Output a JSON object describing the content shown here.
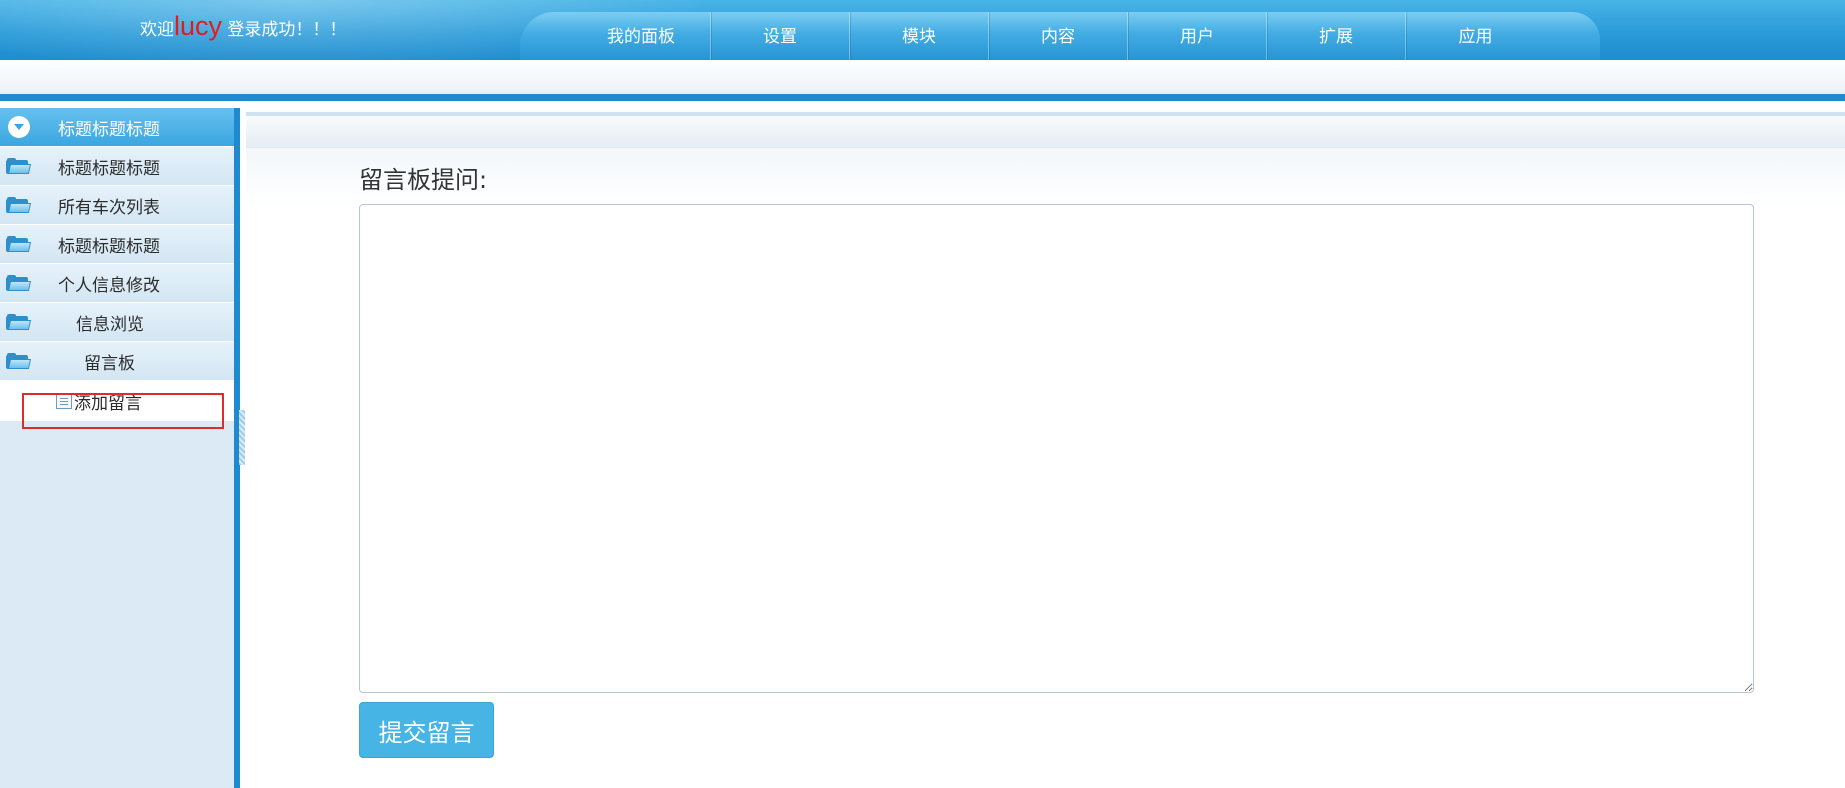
{
  "header": {
    "welcome_prefix": "欢迎",
    "username": "lucy",
    "welcome_suffix": "登录成功！！！",
    "nav_items": [
      "我的面板",
      "设置",
      "模块",
      "内容",
      "用户",
      "扩展",
      "应用"
    ]
  },
  "sidebar": {
    "head": "标题标题标题",
    "items": [
      "标题标题标题",
      "所有车次列表",
      "标题标题标题",
      "个人信息修改",
      "信息浏览",
      "留言板"
    ],
    "sub_item": "添加留言"
  },
  "form": {
    "label": "留言板提问:",
    "textarea_value": "",
    "submit_label": "提交留言"
  },
  "colors": {
    "header_blue": "#2a9bd9",
    "border_blue": "#1e8ad0",
    "button_blue": "#46b4e4",
    "username_red": "#e31b1b",
    "highlight_red": "#e02b2b"
  }
}
